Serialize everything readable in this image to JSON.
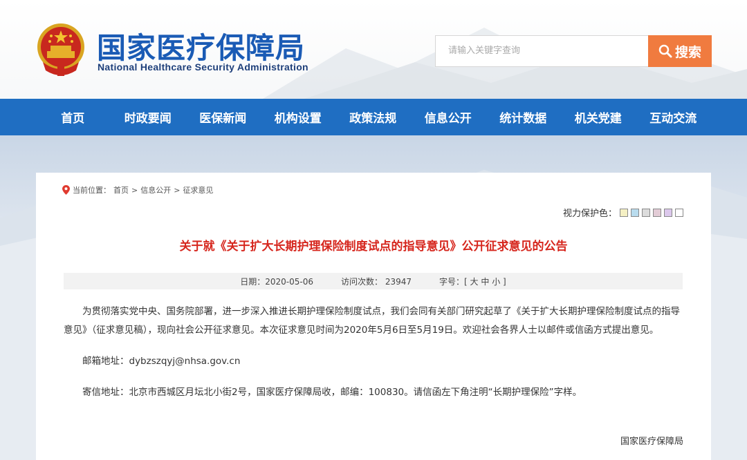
{
  "header": {
    "title": "国家医疗保障局",
    "subtitle": "National Healthcare Security Administration",
    "emblem_icon": "national-emblem-icon"
  },
  "search": {
    "placeholder": "请输入关键字查询",
    "button_label": "搜索",
    "button_icon": "search-icon",
    "accent_color": "#f07b3f"
  },
  "nav": {
    "color": "#1f6ec2",
    "items": [
      "首页",
      "时政要闻",
      "医保新闻",
      "机构设置",
      "政策法规",
      "信息公开",
      "统计数据",
      "机关党建",
      "互动交流"
    ]
  },
  "breadcrumb": {
    "icon": "location-pin-icon",
    "prefix": "当前位置：",
    "items": [
      "首页",
      "信息公开",
      "征求意见"
    ],
    "separator": ">"
  },
  "eye_protect": {
    "label": "视力保护色：",
    "colors": [
      "#f5f0c4",
      "#b9dcee",
      "#dcdcdc",
      "#e3ccd6",
      "#dcc8ec",
      "#ffffff"
    ]
  },
  "article": {
    "title": "关于就《关于扩大长期护理保险制度试点的指导意见》公开征求意见的公告",
    "title_color": "#d6261d",
    "meta": {
      "date": "日期：2020-05-06",
      "visits": "访问次数： 23947",
      "font_size_prefix": "字号：[",
      "font_size_large": "大",
      "font_size_medium": "中",
      "font_size_small": "小",
      "font_size_suffix": "]"
    },
    "paragraph1": "为贯彻落实党中央、国务院部署，进一步深入推进长期护理保险制度试点，我们会同有关部门研究起草了《关于扩大长期护理保险制度试点的指导意见》（征求意见稿），现向社会公开征求意见。本次征求意见时间为2020年5月6日至5月19日。欢迎社会各界人士以邮件或信函方式提出意见。",
    "email": "邮箱地址：dybzszqyj@nhsa.gov.cn",
    "mail": "寄信地址：北京市西城区月坛北小街2号，国家医疗保障局收，邮编：100830。请信函左下角注明“长期护理保险”字样。",
    "signature": "国家医疗保障局"
  }
}
